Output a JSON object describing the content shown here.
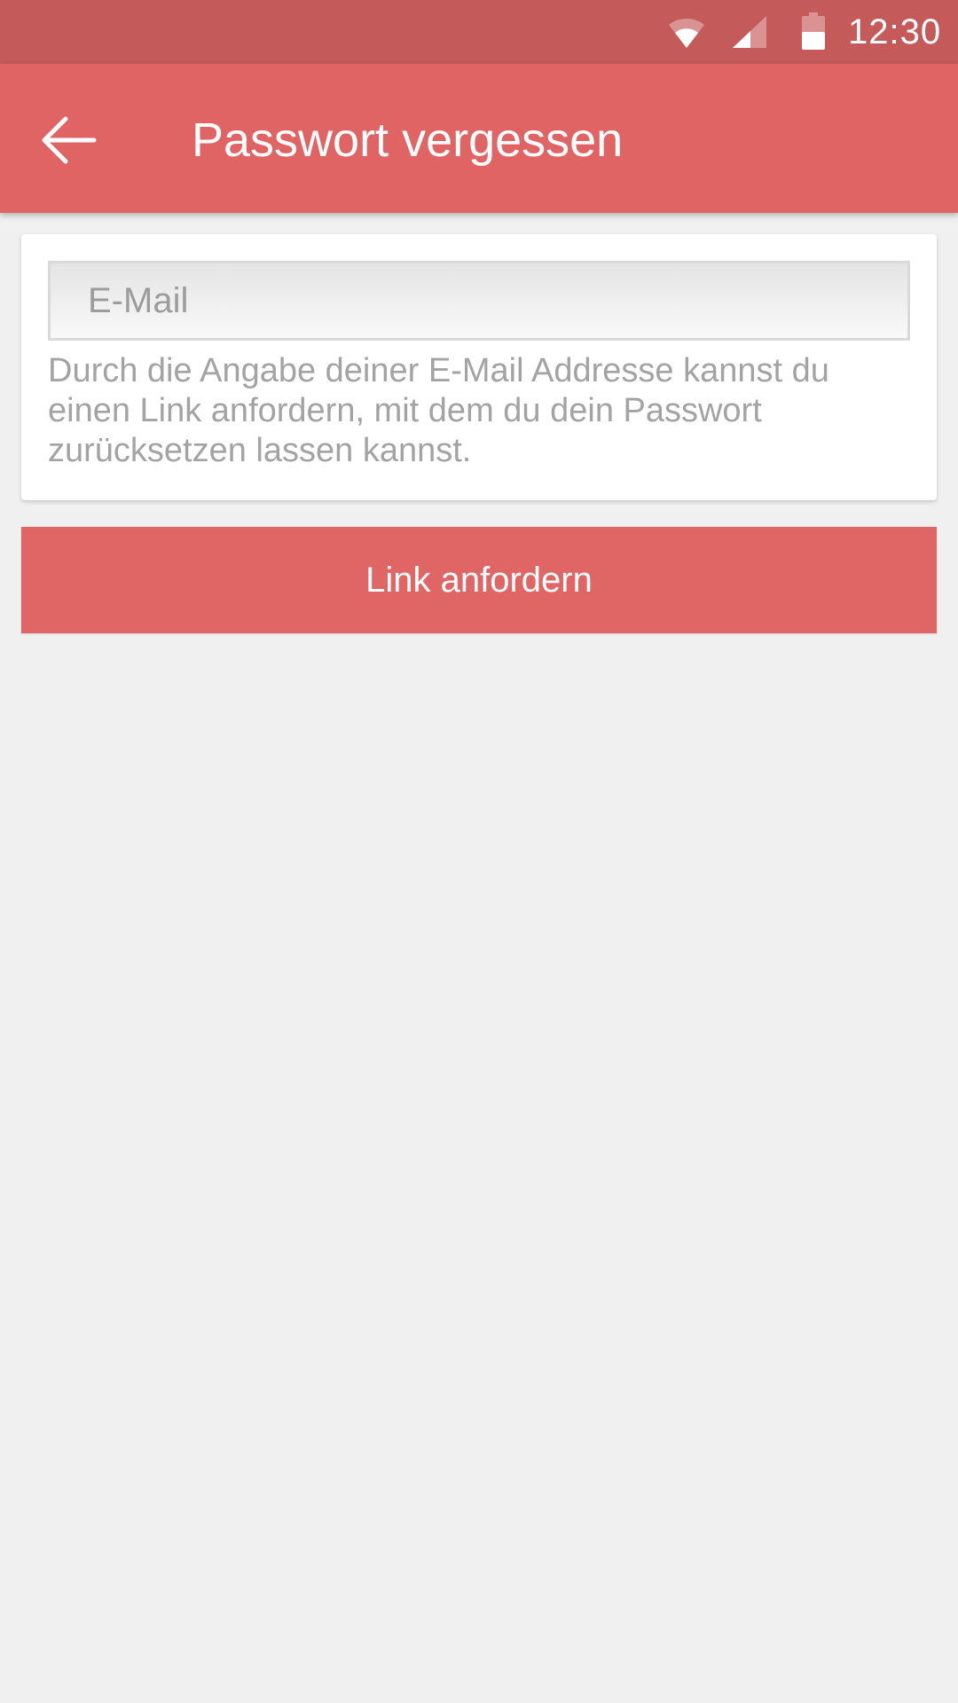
{
  "status_bar": {
    "time": "12:30",
    "icons": [
      "wifi-icon",
      "signal-icon",
      "battery-icon"
    ],
    "color": "#c55a5a"
  },
  "app_bar": {
    "back_icon": "arrow-left-icon",
    "title": "Passwort vergessen",
    "color": "#e06464"
  },
  "form": {
    "email": {
      "placeholder": "E-Mail",
      "value": ""
    },
    "hint": "Durch die Angabe deiner E-Mail Addresse kannst du einen Link anfordern, mit dem du dein Passwort zurücksetzen lassen kannst."
  },
  "actions": {
    "submit_label": "Link anfordern",
    "color": "#e06565"
  },
  "colors": {
    "background": "#f0f0f0",
    "hint_text": "#a3a3a3"
  }
}
